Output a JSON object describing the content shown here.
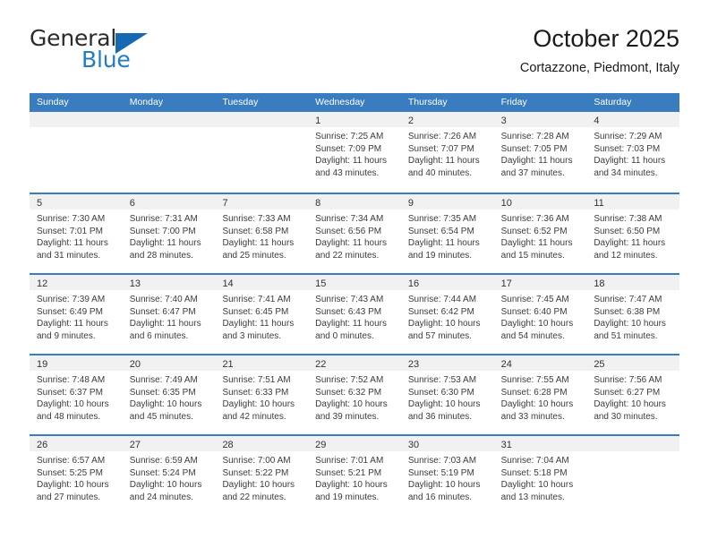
{
  "brand": {
    "name_part1": "General",
    "name_part2": "Blue",
    "flag_icon": "triangle-flag-icon"
  },
  "header": {
    "title": "October 2025",
    "subtitle": "Cortazzone, Piedmont, Italy"
  },
  "colors": {
    "header_blue": "#3a7cc0",
    "brand_blue": "#1f7ec4",
    "flag_blue": "#1668b3",
    "date_band_gray": "#f1f1f1",
    "text": "#1a1a1a"
  },
  "weekdays": [
    "Sunday",
    "Monday",
    "Tuesday",
    "Wednesday",
    "Thursday",
    "Friday",
    "Saturday"
  ],
  "weeks": [
    [
      {
        "empty": true
      },
      {
        "empty": true
      },
      {
        "empty": true
      },
      {
        "date": "1",
        "sunrise": "Sunrise: 7:25 AM",
        "sunset": "Sunset: 7:09 PM",
        "daylight1": "Daylight: 11 hours",
        "daylight2": "and 43 minutes."
      },
      {
        "date": "2",
        "sunrise": "Sunrise: 7:26 AM",
        "sunset": "Sunset: 7:07 PM",
        "daylight1": "Daylight: 11 hours",
        "daylight2": "and 40 minutes."
      },
      {
        "date": "3",
        "sunrise": "Sunrise: 7:28 AM",
        "sunset": "Sunset: 7:05 PM",
        "daylight1": "Daylight: 11 hours",
        "daylight2": "and 37 minutes."
      },
      {
        "date": "4",
        "sunrise": "Sunrise: 7:29 AM",
        "sunset": "Sunset: 7:03 PM",
        "daylight1": "Daylight: 11 hours",
        "daylight2": "and 34 minutes."
      }
    ],
    [
      {
        "date": "5",
        "sunrise": "Sunrise: 7:30 AM",
        "sunset": "Sunset: 7:01 PM",
        "daylight1": "Daylight: 11 hours",
        "daylight2": "and 31 minutes."
      },
      {
        "date": "6",
        "sunrise": "Sunrise: 7:31 AM",
        "sunset": "Sunset: 7:00 PM",
        "daylight1": "Daylight: 11 hours",
        "daylight2": "and 28 minutes."
      },
      {
        "date": "7",
        "sunrise": "Sunrise: 7:33 AM",
        "sunset": "Sunset: 6:58 PM",
        "daylight1": "Daylight: 11 hours",
        "daylight2": "and 25 minutes."
      },
      {
        "date": "8",
        "sunrise": "Sunrise: 7:34 AM",
        "sunset": "Sunset: 6:56 PM",
        "daylight1": "Daylight: 11 hours",
        "daylight2": "and 22 minutes."
      },
      {
        "date": "9",
        "sunrise": "Sunrise: 7:35 AM",
        "sunset": "Sunset: 6:54 PM",
        "daylight1": "Daylight: 11 hours",
        "daylight2": "and 19 minutes."
      },
      {
        "date": "10",
        "sunrise": "Sunrise: 7:36 AM",
        "sunset": "Sunset: 6:52 PM",
        "daylight1": "Daylight: 11 hours",
        "daylight2": "and 15 minutes."
      },
      {
        "date": "11",
        "sunrise": "Sunrise: 7:38 AM",
        "sunset": "Sunset: 6:50 PM",
        "daylight1": "Daylight: 11 hours",
        "daylight2": "and 12 minutes."
      }
    ],
    [
      {
        "date": "12",
        "sunrise": "Sunrise: 7:39 AM",
        "sunset": "Sunset: 6:49 PM",
        "daylight1": "Daylight: 11 hours",
        "daylight2": "and 9 minutes."
      },
      {
        "date": "13",
        "sunrise": "Sunrise: 7:40 AM",
        "sunset": "Sunset: 6:47 PM",
        "daylight1": "Daylight: 11 hours",
        "daylight2": "and 6 minutes."
      },
      {
        "date": "14",
        "sunrise": "Sunrise: 7:41 AM",
        "sunset": "Sunset: 6:45 PM",
        "daylight1": "Daylight: 11 hours",
        "daylight2": "and 3 minutes."
      },
      {
        "date": "15",
        "sunrise": "Sunrise: 7:43 AM",
        "sunset": "Sunset: 6:43 PM",
        "daylight1": "Daylight: 11 hours",
        "daylight2": "and 0 minutes."
      },
      {
        "date": "16",
        "sunrise": "Sunrise: 7:44 AM",
        "sunset": "Sunset: 6:42 PM",
        "daylight1": "Daylight: 10 hours",
        "daylight2": "and 57 minutes."
      },
      {
        "date": "17",
        "sunrise": "Sunrise: 7:45 AM",
        "sunset": "Sunset: 6:40 PM",
        "daylight1": "Daylight: 10 hours",
        "daylight2": "and 54 minutes."
      },
      {
        "date": "18",
        "sunrise": "Sunrise: 7:47 AM",
        "sunset": "Sunset: 6:38 PM",
        "daylight1": "Daylight: 10 hours",
        "daylight2": "and 51 minutes."
      }
    ],
    [
      {
        "date": "19",
        "sunrise": "Sunrise: 7:48 AM",
        "sunset": "Sunset: 6:37 PM",
        "daylight1": "Daylight: 10 hours",
        "daylight2": "and 48 minutes."
      },
      {
        "date": "20",
        "sunrise": "Sunrise: 7:49 AM",
        "sunset": "Sunset: 6:35 PM",
        "daylight1": "Daylight: 10 hours",
        "daylight2": "and 45 minutes."
      },
      {
        "date": "21",
        "sunrise": "Sunrise: 7:51 AM",
        "sunset": "Sunset: 6:33 PM",
        "daylight1": "Daylight: 10 hours",
        "daylight2": "and 42 minutes."
      },
      {
        "date": "22",
        "sunrise": "Sunrise: 7:52 AM",
        "sunset": "Sunset: 6:32 PM",
        "daylight1": "Daylight: 10 hours",
        "daylight2": "and 39 minutes."
      },
      {
        "date": "23",
        "sunrise": "Sunrise: 7:53 AM",
        "sunset": "Sunset: 6:30 PM",
        "daylight1": "Daylight: 10 hours",
        "daylight2": "and 36 minutes."
      },
      {
        "date": "24",
        "sunrise": "Sunrise: 7:55 AM",
        "sunset": "Sunset: 6:28 PM",
        "daylight1": "Daylight: 10 hours",
        "daylight2": "and 33 minutes."
      },
      {
        "date": "25",
        "sunrise": "Sunrise: 7:56 AM",
        "sunset": "Sunset: 6:27 PM",
        "daylight1": "Daylight: 10 hours",
        "daylight2": "and 30 minutes."
      }
    ],
    [
      {
        "date": "26",
        "sunrise": "Sunrise: 6:57 AM",
        "sunset": "Sunset: 5:25 PM",
        "daylight1": "Daylight: 10 hours",
        "daylight2": "and 27 minutes."
      },
      {
        "date": "27",
        "sunrise": "Sunrise: 6:59 AM",
        "sunset": "Sunset: 5:24 PM",
        "daylight1": "Daylight: 10 hours",
        "daylight2": "and 24 minutes."
      },
      {
        "date": "28",
        "sunrise": "Sunrise: 7:00 AM",
        "sunset": "Sunset: 5:22 PM",
        "daylight1": "Daylight: 10 hours",
        "daylight2": "and 22 minutes."
      },
      {
        "date": "29",
        "sunrise": "Sunrise: 7:01 AM",
        "sunset": "Sunset: 5:21 PM",
        "daylight1": "Daylight: 10 hours",
        "daylight2": "and 19 minutes."
      },
      {
        "date": "30",
        "sunrise": "Sunrise: 7:03 AM",
        "sunset": "Sunset: 5:19 PM",
        "daylight1": "Daylight: 10 hours",
        "daylight2": "and 16 minutes."
      },
      {
        "date": "31",
        "sunrise": "Sunrise: 7:04 AM",
        "sunset": "Sunset: 5:18 PM",
        "daylight1": "Daylight: 10 hours",
        "daylight2": "and 13 minutes."
      },
      {
        "empty": true
      }
    ]
  ]
}
